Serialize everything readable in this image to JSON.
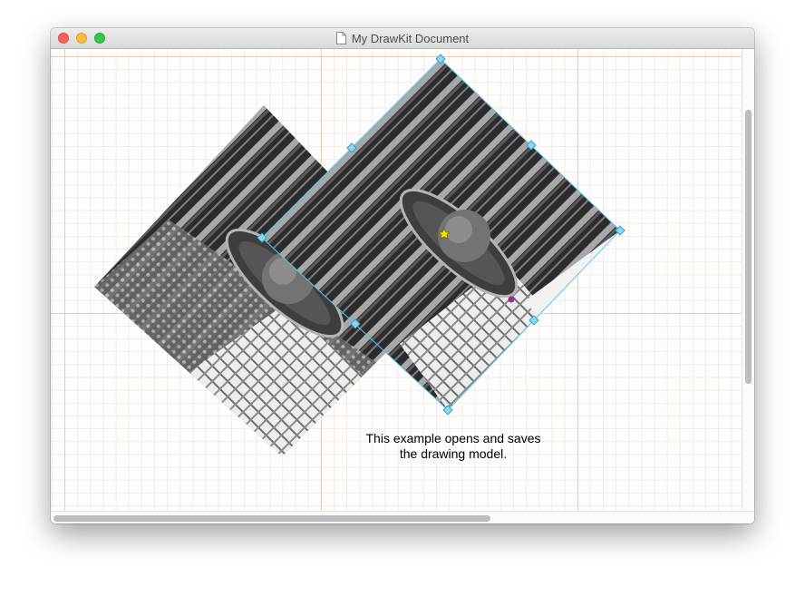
{
  "window": {
    "title": "My DrawKit Document",
    "icon": "document-icon",
    "buttons": [
      "close-button",
      "minimize-button",
      "zoom-button"
    ]
  },
  "canvas": {
    "grid": true,
    "caption": {
      "line1": "This example opens and saves",
      "line2": "the drawing model."
    },
    "shapes": [
      {
        "kind": "rotated-image",
        "selected": false
      },
      {
        "kind": "rotated-image",
        "selected": true
      }
    ]
  },
  "colors": {
    "selection": "#5ac8ea",
    "grid_major": "#d7b996",
    "grid_minor": "#e6d7c8",
    "rotation_knob": "#f2e200",
    "anchor_point": "#9b2a95"
  }
}
